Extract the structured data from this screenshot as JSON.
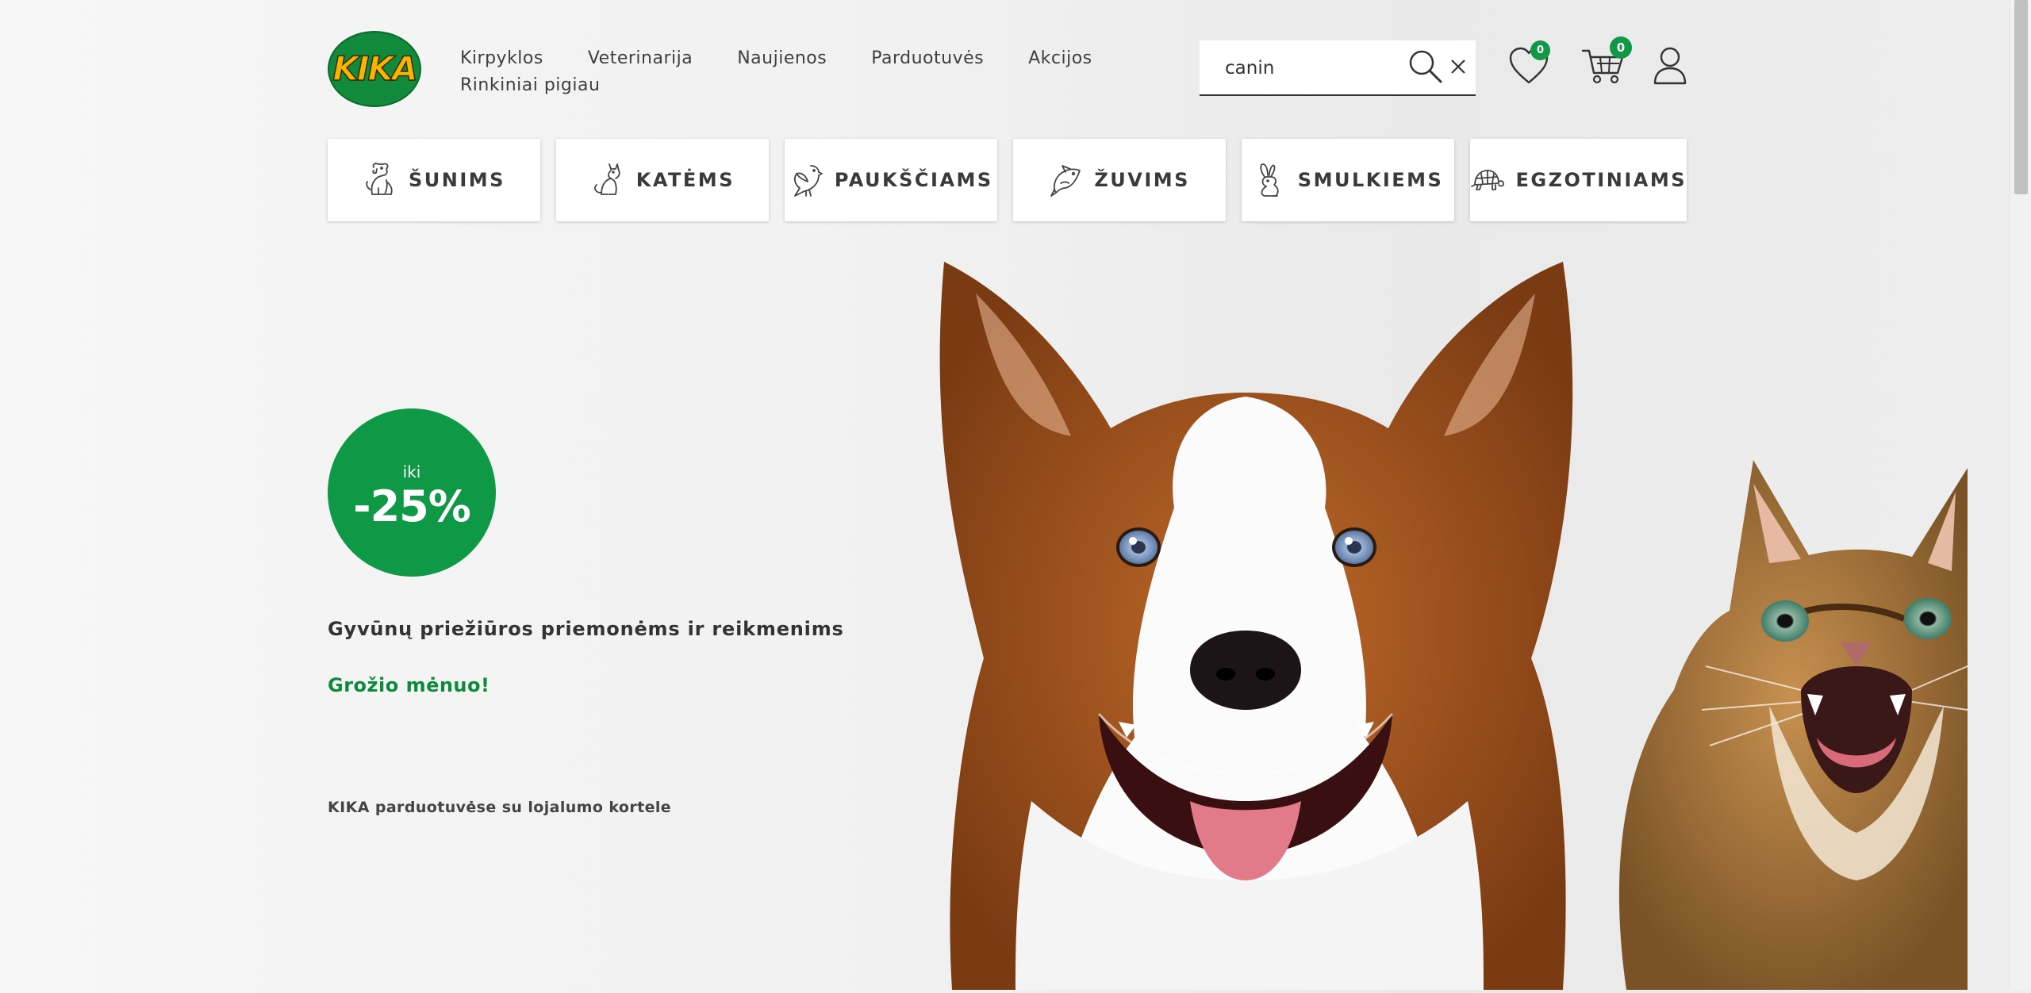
{
  "brand": {
    "logo_text": "KIKA",
    "colors": {
      "green": "#0f9846",
      "yellow": "#f5b400",
      "text": "#333333",
      "link_green": "#0f8a3d"
    }
  },
  "nav": {
    "row1": [
      "Kirpyklos",
      "Veterinarija",
      "Naujienos",
      "Parduotuvės",
      "Akcijos"
    ],
    "row2": [
      "Rinkiniai pigiau"
    ]
  },
  "search": {
    "value": "canin",
    "icon": "search-icon",
    "clear_icon": "close-icon"
  },
  "header_icons": {
    "wishlist": {
      "icon": "heart-icon",
      "count": "0"
    },
    "cart": {
      "icon": "cart-icon",
      "count": "0"
    },
    "account": {
      "icon": "user-icon"
    }
  },
  "categories": [
    {
      "label": "ŠUNIMS",
      "icon": "dog-icon"
    },
    {
      "label": "KATĖMS",
      "icon": "cat-icon"
    },
    {
      "label": "PAUKŠČIAMS",
      "icon": "bird-icon"
    },
    {
      "label": "ŽUVIMS",
      "icon": "fish-icon"
    },
    {
      "label": "SMULKIEMS",
      "icon": "rabbit-icon"
    },
    {
      "label": "EGZOTINIAMS",
      "icon": "turtle-icon"
    }
  ],
  "hero": {
    "promo_prefix": "iki",
    "promo_value": "-25%",
    "title": "Gyvūnų priežiūros priemonėms ir reikmenims",
    "link": "Grožio mėnuo!",
    "note": "KIKA parduotuvėse su lojalumo kortele"
  }
}
